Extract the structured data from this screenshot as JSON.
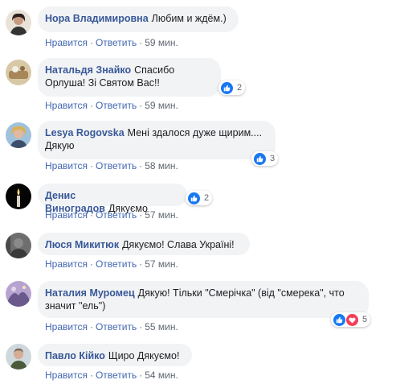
{
  "actions": {
    "like_label": "Нравится",
    "reply_label": "Ответить",
    "separator": "·"
  },
  "comments": [
    {
      "author": "Нора Владимировна",
      "text": "Любим и ждём.)",
      "time": "59 мин.",
      "reactions": null
    },
    {
      "author": "Натальдя Знайко",
      "text": "Спасибо Орлуша! Зі Святом Вас!!",
      "time": "59 мин.",
      "reactions": {
        "types": [
          "like"
        ],
        "count": "2"
      }
    },
    {
      "author": "Lesya Rogovska",
      "text": "Мені здалося дуже щирим.... Дякую",
      "time": "58 мин.",
      "reactions": {
        "types": [
          "like"
        ],
        "count": "3"
      }
    },
    {
      "author": "Денис Виноградов",
      "text": "Дякуємо",
      "time": "57 мин.",
      "reactions": {
        "types": [
          "like"
        ],
        "count": "2"
      }
    },
    {
      "author": "Люся Микитюк",
      "text": "Дякуємо! Слава Україні!",
      "time": "57 мин.",
      "reactions": null
    },
    {
      "author": "Наталия Муромец",
      "text": "Дякую! Тільки \"Смерічка\" (від \"смерека\", что значит \"ель\")",
      "time": "55 мин.",
      "reactions": {
        "types": [
          "like",
          "love"
        ],
        "count": "5"
      }
    },
    {
      "author": "Павло Кійко",
      "text": "Щиро Дякуємо!",
      "time": "54 мин.",
      "reactions": null
    }
  ],
  "colors": {
    "author": "#385898",
    "link": "#4267b2",
    "bubble_bg": "#f2f3f5",
    "like_blue": "#1877f2",
    "love_red": "#f33e58"
  }
}
